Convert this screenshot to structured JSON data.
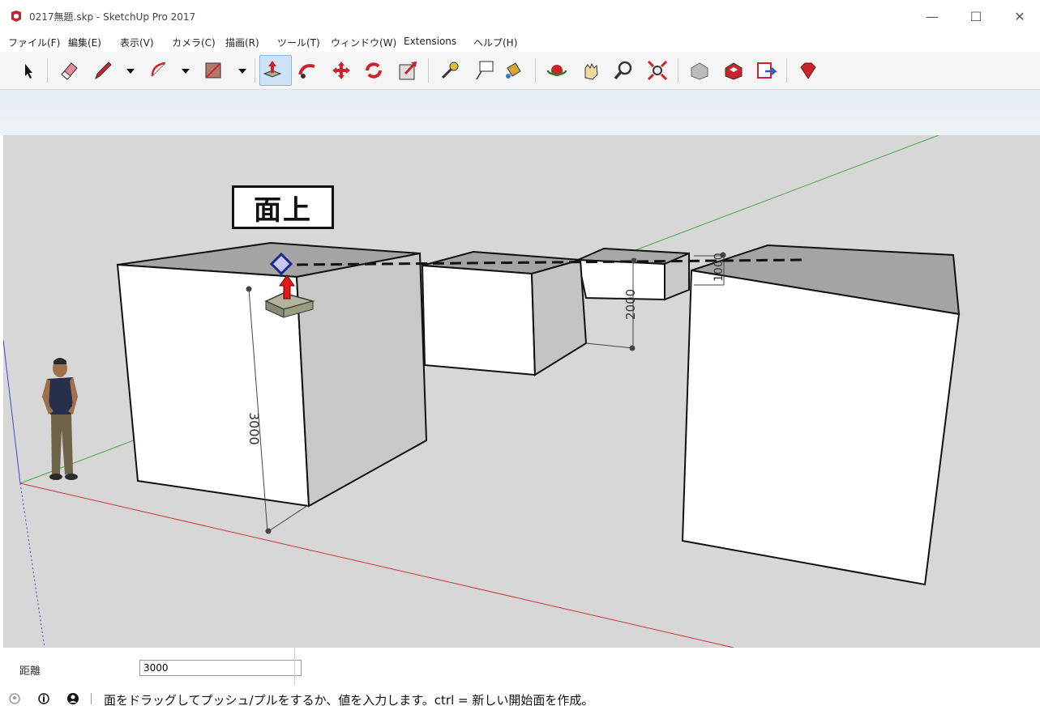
{
  "window": {
    "title": "0217無題.skp - SketchUp Pro 2017",
    "minimize": "—",
    "maximize": "☐",
    "close": "✕"
  },
  "menu": [
    "ファイル(F)",
    "編集(E)",
    "表示(V)",
    "カメラ(C)",
    "描画(R)",
    "ツール(T)",
    "ウィンドウ(W)",
    "Extensions",
    "ヘルプ(H)"
  ],
  "toolbar": {
    "icons": [
      "select-icon",
      "eraser-icon",
      "pencil-icon",
      "arc-icon",
      "rectangle-icon",
      "push-pull-icon",
      "follow-me-icon",
      "move-icon",
      "rotate-icon",
      "scale-icon",
      "tape-measure-icon",
      "text-icon",
      "paint-bucket-icon",
      "orbit-icon",
      "pan-icon",
      "zoom-icon",
      "zoom-extents-icon",
      "3d-warehouse-icon",
      "extension-warehouse-icon",
      "layout-icon",
      "ruby-icon"
    ],
    "active_tool": "push-pull-icon"
  },
  "viewport": {
    "tooltip": "面上",
    "dimensions": {
      "box1_height": "3000",
      "box3_height": "2000",
      "box3_depth": "1000"
    }
  },
  "vcb": {
    "label": "距離",
    "value": "3000"
  },
  "status": {
    "message": "面をドラッグしてプッシュ/プルをするか、値を入力します。ctrl = 新しい開始面を作成。"
  },
  "colors": {
    "viewport_bg": "#d7d7d7",
    "red_axis": "#cc3333",
    "green_axis": "#44aa44",
    "blue_axis": "#4444cc",
    "active_tool_bg": "#cde3f7"
  }
}
